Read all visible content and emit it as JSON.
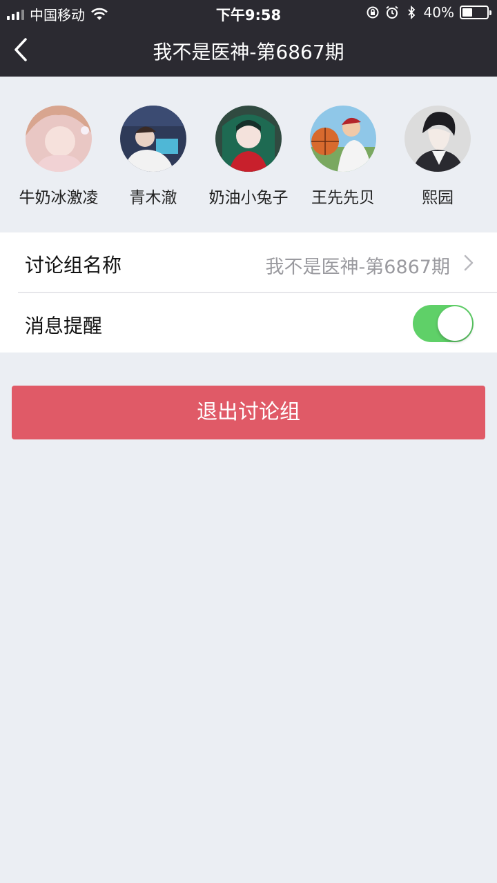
{
  "status_bar": {
    "carrier": "中国移动",
    "time": "下午9:58",
    "battery_percent": "40%",
    "battery_level": 0.4
  },
  "nav": {
    "title": "我不是医神-第6867期",
    "back_icon": "chevron-left-icon"
  },
  "members": [
    {
      "name": "牛奶冰激凌"
    },
    {
      "name": "青木澈"
    },
    {
      "name": "奶油小兔子"
    },
    {
      "name": "王先先贝"
    },
    {
      "name": "熙园"
    }
  ],
  "settings": {
    "group_name_label": "讨论组名称",
    "group_name_value": "我不是医神-第6867期",
    "notify_label": "消息提醒",
    "notify_on": true
  },
  "exit_button": {
    "label": "退出讨论组"
  },
  "colors": {
    "header_bg": "#2b2a31",
    "page_bg": "#ebeef3",
    "switch_on": "#5fd068",
    "exit_button": "#e05a67"
  }
}
